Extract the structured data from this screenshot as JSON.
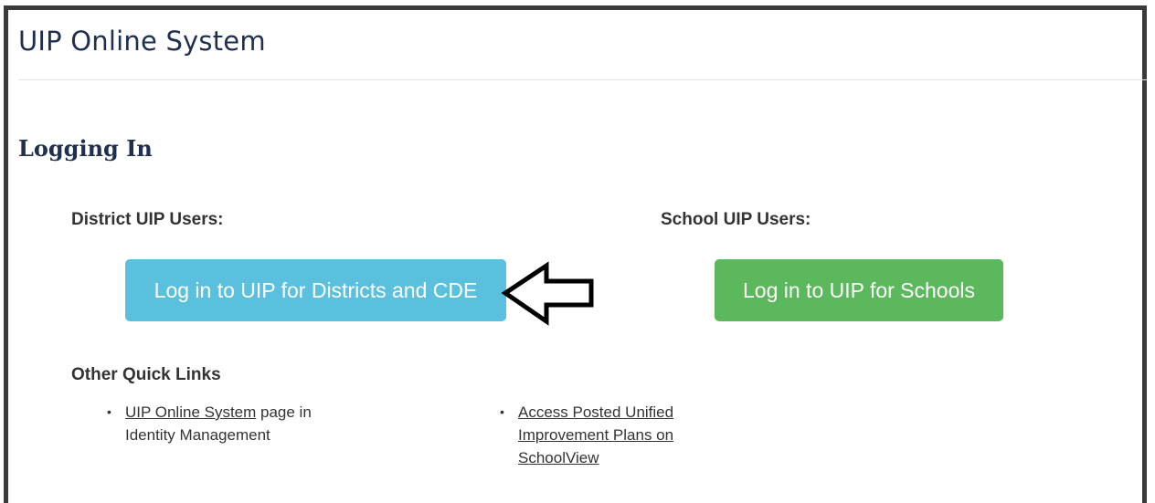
{
  "header": {
    "title": "UIP Online System"
  },
  "main": {
    "heading": "Logging In",
    "district": {
      "label": "District UIP Users:",
      "button_label": "Log in to UIP for Districts and CDE"
    },
    "school": {
      "label": "School UIP Users:",
      "button_label": "Log in to UIP for Schools"
    },
    "quick_links": {
      "heading": "Other Quick Links",
      "left": {
        "link_text": "UIP Online System",
        "after_link_line1": " page in",
        "line2": "Identity Management"
      },
      "right": {
        "line1": "Access Posted Unified",
        "line2": "Improvement Plans on",
        "line3": "SchoolView"
      },
      "bullet": "•"
    }
  },
  "colors": {
    "district_button": "#5bc0de",
    "school_button": "#5cb85c",
    "heading_text": "#1f2f4f",
    "frame_border": "#3a3a3a"
  },
  "icons": {
    "annotation_arrow": "left-arrow-outline-icon"
  }
}
